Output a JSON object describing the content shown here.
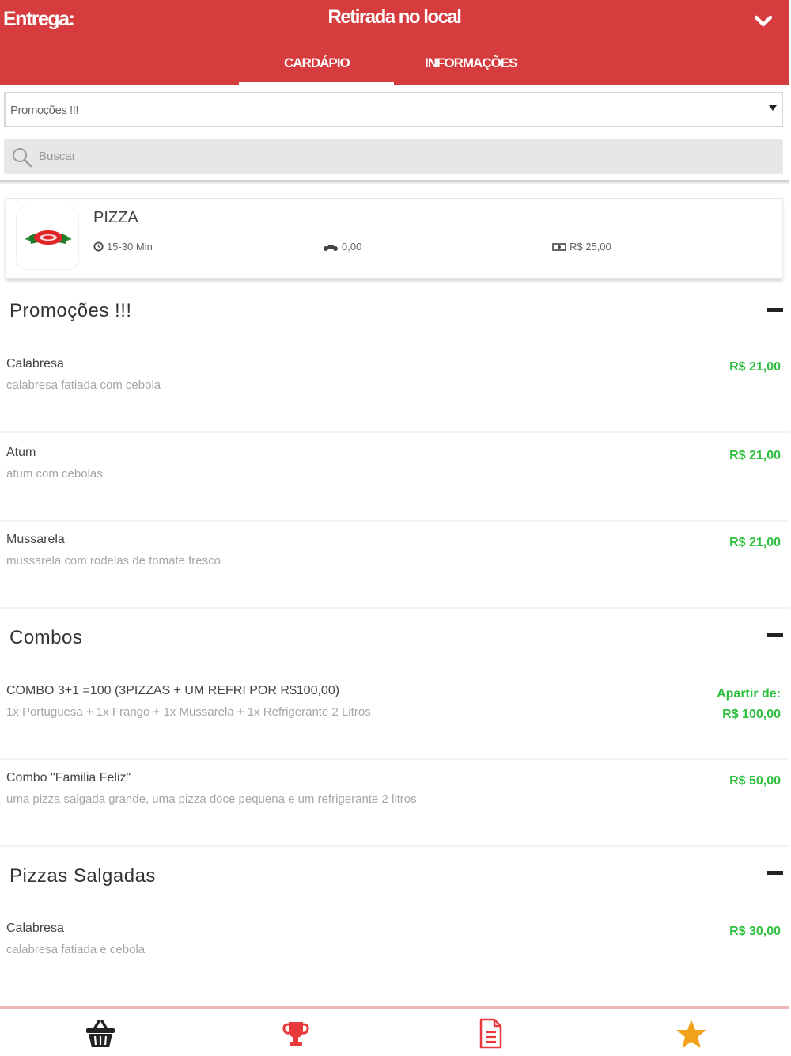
{
  "header": {
    "delivery_label": "Entrega:",
    "delivery_mode": "Retirada no local",
    "tabs": [
      {
        "label": "CARDÁPIO",
        "active": true
      },
      {
        "label": "INFORMAÇÕES",
        "active": false
      }
    ]
  },
  "filter": {
    "selected": "Promoções !!!"
  },
  "search": {
    "placeholder": "Buscar"
  },
  "store": {
    "name": "PIZZA",
    "delivery_time": "15-30 Min",
    "delivery_fee": "0,00",
    "min_order": "R$ 25,00"
  },
  "sections": [
    {
      "title": "Promoções !!!",
      "items": [
        {
          "name": "Calabresa",
          "description": "calabresa fatiada com cebola",
          "price": "R$ 21,00"
        },
        {
          "name": "Atum",
          "description": "atum com cebolas",
          "price": "R$ 21,00"
        },
        {
          "name": "Mussarela",
          "description": "mussarela com rodelas de tomate fresco",
          "price": "R$ 21,00"
        }
      ]
    },
    {
      "title": "Combos",
      "items": [
        {
          "name": "COMBO 3+1 =100 (3PIZZAS + UM REFRI POR R$100,00)",
          "description": "1x Portuguesa + 1x Frango + 1x Mussarela + 1x Refrigerante 2 Litros",
          "price_prefix": "Apartir de:",
          "price": "R$ 100,00"
        },
        {
          "name": "Combo \"Familia Feliz\"",
          "description": "uma pizza salgada grande, uma pizza doce pequena e um refrigerante 2 litros",
          "price": "R$ 50,00"
        }
      ]
    },
    {
      "title": "Pizzas Salgadas",
      "items": [
        {
          "name": "Calabresa",
          "description": "calabresa fatiada e cebola",
          "price": "R$ 30,00"
        }
      ]
    }
  ],
  "bottom_nav": [
    {
      "icon": "basket-icon"
    },
    {
      "icon": "trophy-icon"
    },
    {
      "icon": "document-icon"
    },
    {
      "icon": "star-icon"
    }
  ],
  "colors": {
    "brand": "#d63b3e",
    "price": "#2fbf3f",
    "star": "#f0a21b"
  }
}
